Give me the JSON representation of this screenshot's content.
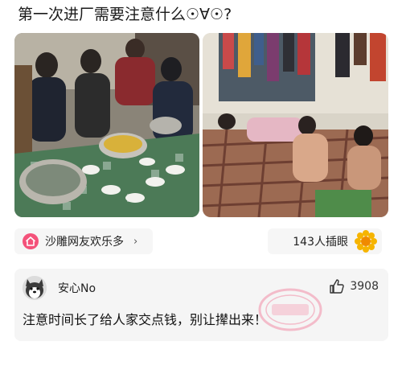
{
  "post": {
    "title": "第一次进厂需要注意什么☉∀☉?"
  },
  "topic": {
    "label": "沙雕网友欢乐多",
    "arrow": "›",
    "icon": "house-icon"
  },
  "reaction": {
    "label": "143人插眼",
    "icon": "sunflower-icon"
  },
  "comment": {
    "username": "安心No",
    "likes": "3908",
    "text": "注意时间长了给人家交点钱，别让撵出来！",
    "avatar_icon": "husky-dog-icon",
    "like_icon": "thumbs-up-icon"
  },
  "colors": {
    "accent": "#f4527a",
    "chip_bg": "#f6f6f6",
    "card_bg": "#f5f5f5"
  }
}
